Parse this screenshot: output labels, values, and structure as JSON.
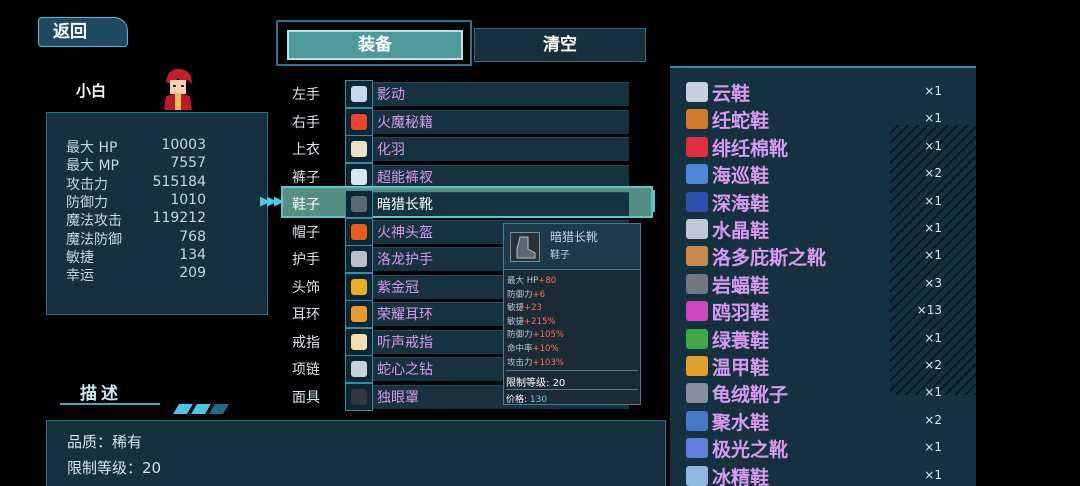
{
  "back_label": "返回",
  "character": {
    "name": "小白",
    "stats": [
      {
        "label": "最大 HP",
        "value": "10003"
      },
      {
        "label": "最大 MP",
        "value": "7557"
      },
      {
        "label": "攻击力",
        "value": "515184"
      },
      {
        "label": "防御力",
        "value": "1010"
      },
      {
        "label": "魔法攻击",
        "value": "119212"
      },
      {
        "label": "魔法防御",
        "value": "768"
      },
      {
        "label": "敏捷",
        "value": "134"
      },
      {
        "label": "幸运",
        "value": "209"
      }
    ]
  },
  "description": {
    "title": "描述",
    "quality": "品质：稀有",
    "level": "限制等级：20"
  },
  "tabs": {
    "equip": "装备",
    "clear": "清空"
  },
  "slots": [
    {
      "label": "左手",
      "item": "影动",
      "color": "#c8d8f0"
    },
    {
      "label": "右手",
      "item": "火魔秘籍",
      "color": "#e8452c"
    },
    {
      "label": "上衣",
      "item": "化羽",
      "color": "#e9e2c8"
    },
    {
      "label": "裤子",
      "item": "超能裤衩",
      "color": "#d8e8f0"
    },
    {
      "label": "鞋子",
      "item": "暗猎长靴",
      "color": "#5a6874"
    },
    {
      "label": "帽子",
      "item": "火神头盔",
      "color": "#e85a20"
    },
    {
      "label": "护手",
      "item": "洛龙护手",
      "color": "#b8c0c8"
    },
    {
      "label": "头饰",
      "item": "紫金冠",
      "color": "#e8b020"
    },
    {
      "label": "耳环",
      "item": "荣耀耳环",
      "color": "#e89a30"
    },
    {
      "label": "戒指",
      "item": "听声戒指",
      "color": "#f0e0b0"
    },
    {
      "label": "项链",
      "item": "蛇心之钻",
      "color": "#c8d0d8"
    },
    {
      "label": "面具",
      "item": "独眼罩",
      "color": "#303840"
    }
  ],
  "tooltip": {
    "title": "暗猎长靴",
    "type": "鞋子",
    "stats": [
      {
        "label": "最大 HP",
        "value": "+80"
      },
      {
        "label": "防御力",
        "value": "+6"
      },
      {
        "label": "敏捷",
        "value": "+23"
      },
      {
        "label": "敏捷",
        "value": "+215%"
      },
      {
        "label": "防御力",
        "value": "+105%"
      },
      {
        "label": "命中率",
        "value": "+10%"
      },
      {
        "label": "攻击力",
        "value": "+103%"
      }
    ],
    "level_label": "限制等级:",
    "level_value": "20",
    "price_label": "价格:",
    "price_value": "130"
  },
  "inventory": [
    {
      "name": "云鞋",
      "qty": "×1",
      "color": "#c8d0e0"
    },
    {
      "name": "纴蛇鞋",
      "qty": "×1",
      "color": "#d07a30"
    },
    {
      "name": "绯纴棉靴",
      "qty": "×1",
      "color": "#e03040"
    },
    {
      "name": "海巡鞋",
      "qty": "×2",
      "color": "#5088d8"
    },
    {
      "name": "深海鞋",
      "qty": "×1",
      "color": "#3050b0"
    },
    {
      "name": "水晶鞋",
      "qty": "×1",
      "color": "#c0c8d8"
    },
    {
      "name": "洛多庇斯之靴",
      "qty": "×1",
      "color": "#c88850"
    },
    {
      "name": "岩蝠鞋",
      "qty": "×3",
      "color": "#707880"
    },
    {
      "name": "鸥羽鞋",
      "qty": "×13",
      "color": "#d048c0"
    },
    {
      "name": "绿蓑鞋",
      "qty": "×1",
      "color": "#40a848"
    },
    {
      "name": "温甲鞋",
      "qty": "×2",
      "color": "#e0a030"
    },
    {
      "name": "龟绒靴子",
      "qty": "×1",
      "color": "#8890a0"
    },
    {
      "name": "聚水鞋",
      "qty": "×2",
      "color": "#4878c8"
    },
    {
      "name": "极光之靴",
      "qty": "×1",
      "color": "#6080e0"
    },
    {
      "name": "冰精鞋",
      "qty": "×1",
      "color": "#90b8e0"
    }
  ]
}
